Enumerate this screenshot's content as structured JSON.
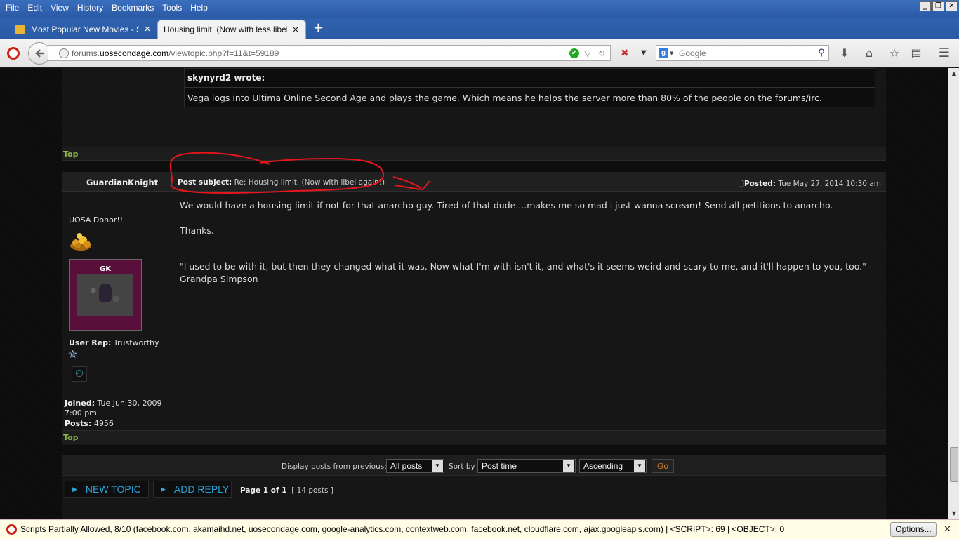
{
  "menu": [
    "File",
    "Edit",
    "View",
    "History",
    "Bookmarks",
    "Tools",
    "Help"
  ],
  "window_controls": {
    "minimize": "_",
    "restore": "❐",
    "close": "✕"
  },
  "tabs": [
    {
      "title": "Most Popular New Movies - S...",
      "close": "✕"
    },
    {
      "title": "Housing limit. (Now with less libel!)...",
      "close": "✕"
    }
  ],
  "new_tab": "+",
  "navbar": {
    "url_host_prefix": "forums.",
    "url_host": "uosecondage.com",
    "url_path": "/viewtopic.php?f=11&t=59189",
    "search_engine": "g",
    "search_placeholder": "Google"
  },
  "quote": {
    "author": "skynyrd2 wrote:",
    "body": "Vega logs into Ultima Online Second Age and plays the game. Which means he helps the server more than 80% of the people on the forums/irc."
  },
  "top_link": "Top",
  "post": {
    "author": "GuardianKnight",
    "subject_label": "Post subject:",
    "subject": " Re: Housing limit. (Now with libel again!)",
    "posted_label": "Posted:",
    "posted": " Tue May 27, 2014 10:30 am",
    "body_line1": "We would have a housing limit if not for that anarcho guy. Tired of that dude....makes me so mad i just wanna scream! Send all petitions to anarcho.",
    "body_line2": "Thanks.",
    "signature": "\"I used to be with it, but then they changed what it was. Now what I'm with isn't it, and what's it seems weird and scary to me, and it'll happen to you, too.\" Grandpa Simpson"
  },
  "profile": {
    "rank": "UOSA Donor!!",
    "avatar_label": "GK",
    "rep_label": "User Rep:",
    "rep_value": " Trustworthy",
    "joined_label": "Joined:",
    "joined_value": " Tue Jun 30, 2009",
    "joined_time": "7:00 pm",
    "posts_label": "Posts:",
    "posts_value": " 4956"
  },
  "sort_bar": {
    "display_label": "Display posts from previous:",
    "display_value": "All posts",
    "sort_label": "Sort by",
    "sort_value": "Post time",
    "order_value": "Ascending",
    "go": "Go"
  },
  "actions": {
    "new_topic": "NEW TOPIC",
    "add_reply": "ADD REPLY",
    "page_text": "Page ",
    "page_current": "1",
    "page_of": " of ",
    "page_total": "1",
    "post_count": "[ 14 posts ]"
  },
  "notification": {
    "text": "Scripts Partially Allowed, 8/10 (facebook.com, akamaihd.net, uosecondage.com, google-analytics.com, contextweb.com, facebook.net, cloudflare.com, ajax.googleapis.com) | <SCRIPT>: 69 | <OBJECT>: 0",
    "options": "Options...",
    "close": "✕"
  },
  "colors": {
    "link_green": "#8db54a",
    "button_blue": "#2aa4d8",
    "annotation_red": "#e8141e",
    "go_orange": "#d87a2a"
  }
}
